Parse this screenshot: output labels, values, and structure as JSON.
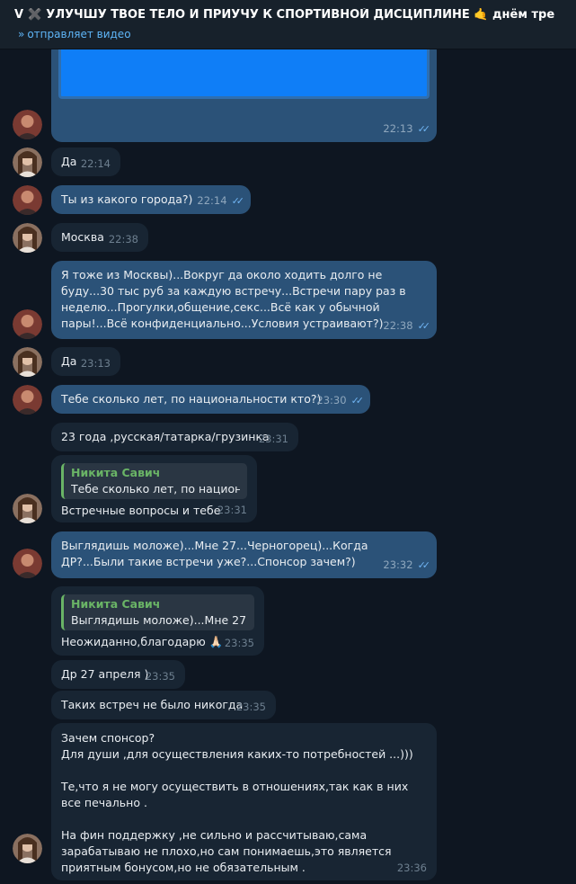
{
  "header": {
    "title": "V ✖️ УЛУЧШУ ТВОЕ ТЕЛО И ПРИУЧУ К СПОРТИВНОЙ ДИСЦИПЛИНЕ 🤙 днём тре",
    "status_icon": "forward-arrows-icon",
    "status": "отправляет видео"
  },
  "colors": {
    "background": "#0e1621",
    "header": "#17212b",
    "incoming_bubble": "#182533",
    "outgoing_bubble": "#2b5278",
    "accent": "#5eb5f7",
    "reply_name": "#6ab466",
    "media": "#0f7ef7"
  },
  "messages": [
    {
      "dir": "out",
      "type": "media",
      "text": "",
      "time": "22:13",
      "read": true
    },
    {
      "dir": "in",
      "text": "Да",
      "time": "22:14"
    },
    {
      "dir": "out",
      "text": "Ты из какого города?)",
      "time": "22:14",
      "read": true
    },
    {
      "dir": "in",
      "text": "Москва",
      "time": "22:38"
    },
    {
      "dir": "out",
      "text": "Я тоже из Москвы)...Вокруг да около ходить долго не буду...30 тыс руб за каждую встречу...Встречи пару раз в неделю...Прогулки,общение,секс...Всё как у обычной пары!...Всё конфиденциально...Условия устраивают?)",
      "time": "22:38",
      "read": true
    },
    {
      "dir": "in",
      "text": "Да",
      "time": "23:13"
    },
    {
      "dir": "out",
      "text": "Тебе сколько лет, по национальности кто?)",
      "time": "23:30",
      "read": true
    },
    {
      "dir": "in",
      "text": "23 года ,русская/татарка/грузинка",
      "time": "23:31"
    },
    {
      "dir": "in",
      "reply_name": "Никита Савич",
      "reply_text": "Тебе сколько лет, по национ...",
      "text": "Встречные вопросы и тебе",
      "time": "23:31"
    },
    {
      "dir": "out",
      "text": "Выглядишь моложе)...Мне 27...Черногорец)...Когда ДР?...Были такие встречи уже?...Спонсор зачем?)",
      "time": "23:32",
      "read": true
    },
    {
      "dir": "in",
      "reply_name": "Никита Савич",
      "reply_text": "Выглядишь моложе)...Мне 27.....",
      "text": "Неожиданно,благодарю 🙏🏻",
      "time": "23:35"
    },
    {
      "dir": "in",
      "text": "Др 27 апреля )",
      "time": "23:35"
    },
    {
      "dir": "in",
      "text": "Таких встреч не было никогда",
      "time": "23:35"
    },
    {
      "dir": "in",
      "text": "Зачем спонсор?\nДля души ,для осуществления каких-то потребностей ...)))\n\nТе,что я не могу осуществить в отношениях,так как в них все печально .\n\nНа фин поддержку ,не сильно и рассчитываю,сама зарабатываю не плохо,но сам понимаешь,это является приятным бонусом,но не обязательным .",
      "time": "23:36"
    }
  ],
  "read_mark": "✓✓"
}
